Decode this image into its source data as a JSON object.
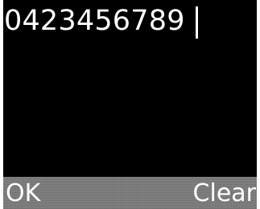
{
  "entry": {
    "value": "0423456789"
  },
  "softkeys": {
    "left_label": "OK",
    "right_label": "Clear"
  },
  "colors": {
    "screen_background": "#000000",
    "text": "#ffffff",
    "softkey_bar": "#7f7f7f"
  }
}
